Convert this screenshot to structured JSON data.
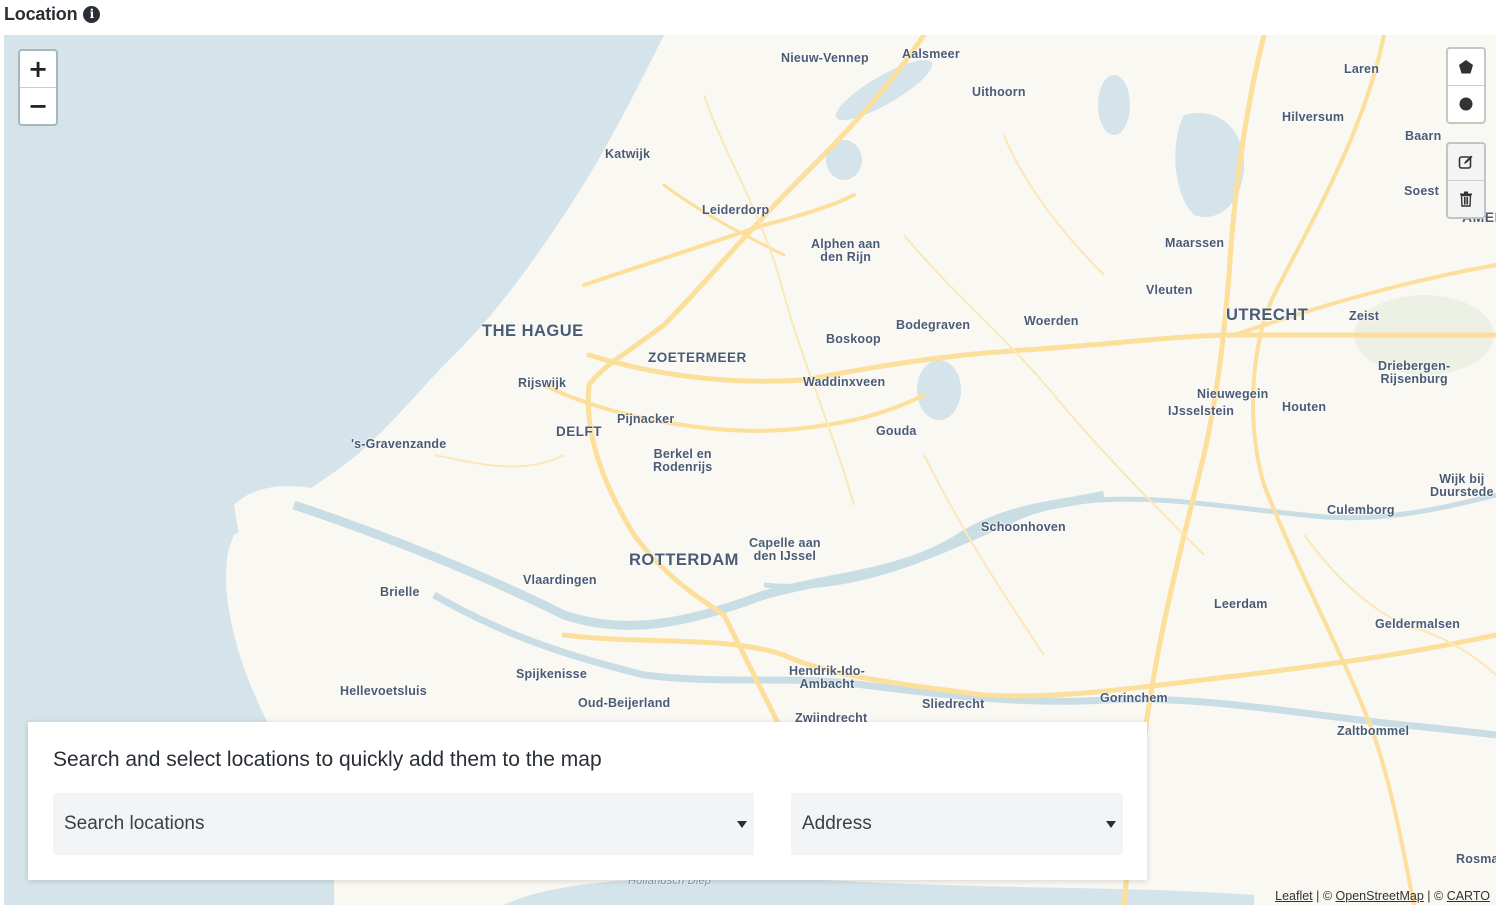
{
  "section": {
    "title": "Location",
    "info_icon": "info-icon"
  },
  "map": {
    "colors": {
      "water": "#d4e4ea",
      "land": "#faf8f3",
      "road": "#fbdf9b",
      "minor_road": "#fbe8b8",
      "label": "#4a5b74"
    },
    "zoom_in_label": "+",
    "zoom_out_label": "−",
    "draw_tools": [
      {
        "name": "draw-polygon",
        "icon": "pentagon-icon"
      },
      {
        "name": "draw-circle",
        "icon": "circle-icon"
      },
      {
        "name": "edit-layers",
        "icon": "edit-icon"
      },
      {
        "name": "delete-layers",
        "icon": "trash-icon"
      }
    ],
    "labels": {
      "nieuw_vennep": "Nieuw-Vennep",
      "aalsmeer": "Aalsmeer",
      "uithoorn": "Uithoorn",
      "laren": "Laren",
      "hilversum": "Hilversum",
      "baarn": "Baarn",
      "soest": "Soest",
      "amersfoort_partial": "AMEI",
      "katwijk": "Katwijk",
      "leiderdorp": "Leiderdorp",
      "alphen": "Alphen aan\nden Rijn",
      "maarssen": "Maarssen",
      "vleuten": "Vleuten",
      "the_hague": "THE HAGUE",
      "utrecht": "UTRECHT",
      "zeist": "Zeist",
      "bodegraven": "Bodegraven",
      "woerden": "Woerden",
      "boskoop": "Boskoop",
      "zoetermeer": "ZOETERMEER",
      "driebergen": "Driebergen-\nRijsenburg",
      "rijswijk": "Rijswijk",
      "waddinxveen": "Waddinxveen",
      "nieuwegein": "Nieuwegein",
      "ijsselstein": "IJsselstein",
      "houten": "Houten",
      "pijnacker": "Pijnacker",
      "delft": "DELFT",
      "gouda": "Gouda",
      "gravenzande": "'s-Gravenzande",
      "berkel": "Berkel en\nRodenrijs",
      "wijk_bij_duurstede": "Wijk bij\nDuurstede",
      "culemborg": "Culemborg",
      "schoonhoven": "Schoonhoven",
      "capelle": "Capelle aan\nden IJssel",
      "rotterdam": "ROTTERDAM",
      "vlaardingen": "Vlaardingen",
      "brielle": "Brielle",
      "leerdam": "Leerdam",
      "geldermalsen": "Geldermalsen",
      "spijkenisse": "Spijkenisse",
      "hendrik_ido": "Hendrik-Ido-\nAmbacht",
      "hellevoetsluis": "Hellevoetsluis",
      "oud_beijerland": "Oud-Beijerland",
      "gorinchem": "Gorinchem",
      "sliedrecht": "Sliedrecht",
      "zwijndrecht": "Zwijndrecht",
      "zaltbommel": "Zaltbommel",
      "rosmalen_partial": "Rosma",
      "hollandsch_diep": "Hollandsch Diep"
    },
    "attribution": {
      "leaflet": "Leaflet",
      "sep1": " | © ",
      "osm": "OpenStreetMap",
      "sep2": " | © ",
      "carto": "CARTO"
    }
  },
  "search_panel": {
    "heading": "Search and select locations to quickly add them to the map",
    "search_select": {
      "value": "",
      "placeholder": "Search locations"
    },
    "type_select": {
      "value": "Address"
    }
  }
}
